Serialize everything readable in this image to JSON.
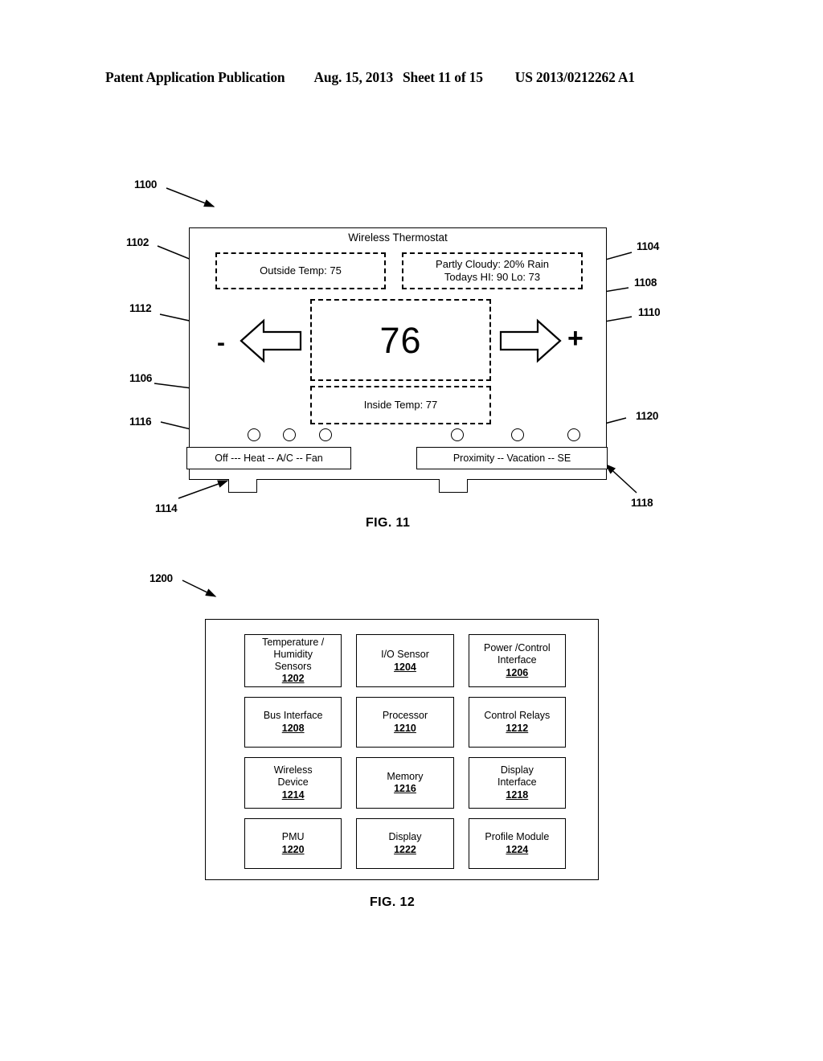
{
  "page_header": {
    "publication": "Patent Application Publication",
    "date": "Aug. 15, 2013",
    "sheet": "Sheet 11 of 15",
    "publication_number": "US 2013/0212262 A1"
  },
  "fig11": {
    "caption": "FIG. 11",
    "device_title": "Wireless Thermostat",
    "outside_temp": "Outside Temp: 75",
    "weather_line1": "Partly Cloudy: 20% Rain",
    "weather_line2": "Todays HI: 90  Lo: 73",
    "setpoint": "76",
    "inside_temp": "Inside Temp: 77",
    "minus_sign": "-",
    "plus_sign": "+",
    "mode_bar_left": "Off --- Heat -- A/C -- Fan",
    "mode_bar_right": "Proximity -- Vacation --   SE",
    "refs": {
      "r1100": "1100",
      "r1102": "1102",
      "r1104": "1104",
      "r1106": "1106",
      "r1108": "1108",
      "r1110": "1110",
      "r1112": "1112",
      "r1114": "1114",
      "r1116": "1116",
      "r1118": "1118",
      "r1120": "1120"
    }
  },
  "fig12": {
    "caption": "FIG. 12",
    "ref_1200": "1200",
    "blocks": [
      {
        "label": "Temperature /\nHumidity\nSensors",
        "num": "1202"
      },
      {
        "label": "I/O Sensor",
        "num": "1204"
      },
      {
        "label": "Power /Control\nInterface",
        "num": "1206"
      },
      {
        "label": "Bus Interface",
        "num": "1208"
      },
      {
        "label": "Processor",
        "num": "1210"
      },
      {
        "label": "Control Relays",
        "num": "1212"
      },
      {
        "label": "Wireless\nDevice",
        "num": "1214"
      },
      {
        "label": "Memory",
        "num": "1216"
      },
      {
        "label": "Display\nInterface",
        "num": "1218"
      },
      {
        "label": "PMU",
        "num": "1220"
      },
      {
        "label": "Display",
        "num": "1222"
      },
      {
        "label": "Profile Module",
        "num": "1224"
      }
    ]
  },
  "colors": {
    "ink": "#000000",
    "paper": "#ffffff"
  }
}
